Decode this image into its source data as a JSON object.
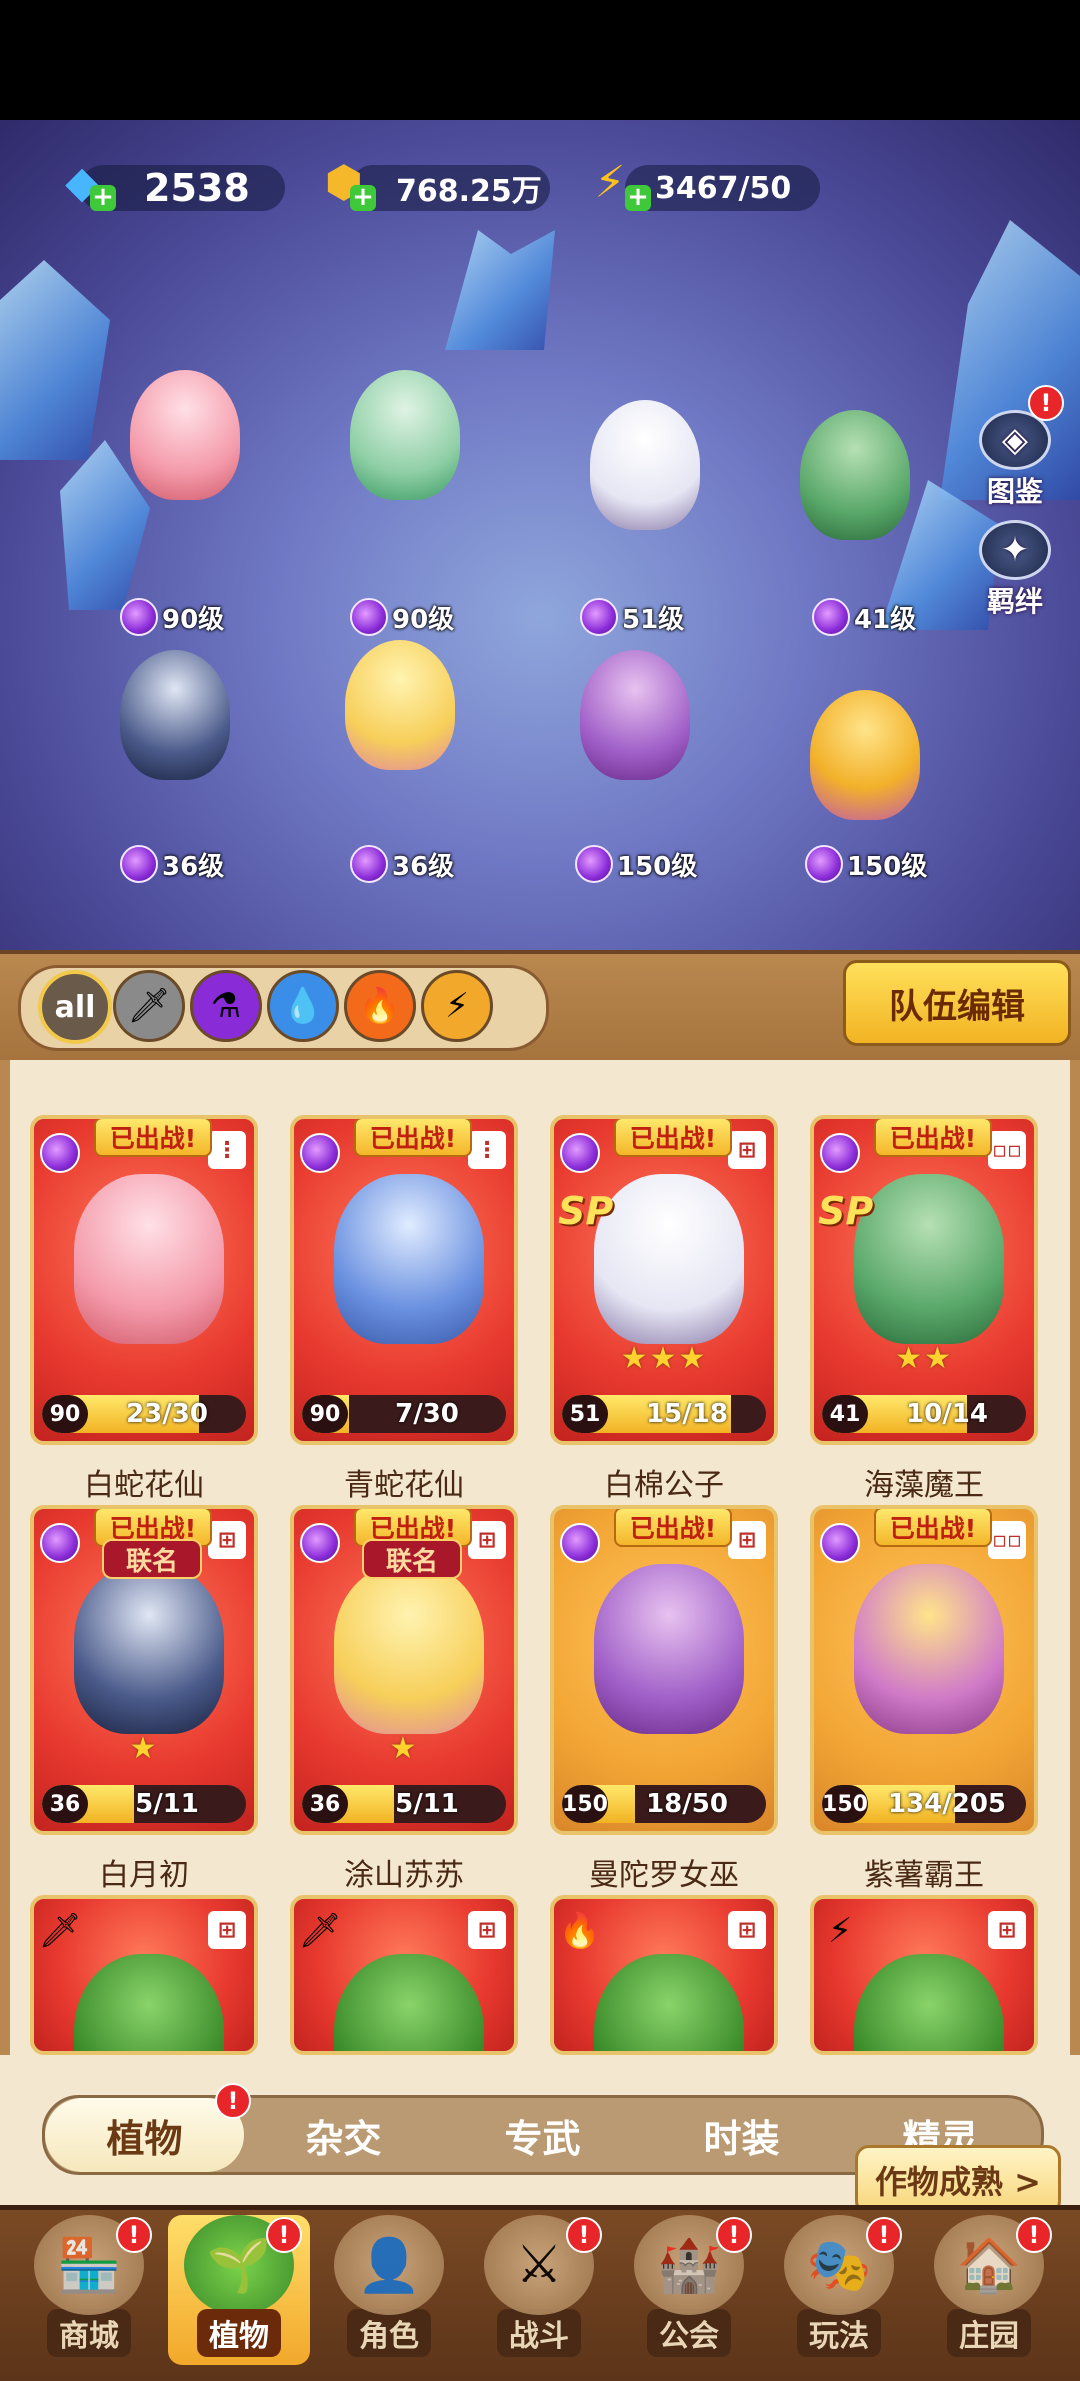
{
  "resources": {
    "gems": "2538",
    "coins": "768.25万",
    "energy": "3467/50"
  },
  "scene": {
    "side_buttons": [
      {
        "label": "图鉴",
        "icon": "codex-icon",
        "badge": "!"
      },
      {
        "label": "羁绊",
        "icon": "bond-icon",
        "badge": ""
      }
    ],
    "heroes": [
      {
        "level": "90级"
      },
      {
        "level": "90级"
      },
      {
        "level": "51级"
      },
      {
        "level": "41级"
      },
      {
        "level": "36级"
      },
      {
        "level": "36级"
      },
      {
        "level": "150级"
      },
      {
        "level": "150级"
      }
    ]
  },
  "filters": {
    "all_label": "all",
    "icons": [
      "sword-icon",
      "potion-icon",
      "water-icon",
      "fire-icon",
      "lightning-icon"
    ]
  },
  "team_edit_label": "队伍编辑",
  "cards": [
    {
      "name": "白蛇花仙",
      "sticker": "已出战!",
      "level": "90",
      "progress": "23/30",
      "fill": 0.77,
      "stars": "",
      "sp": "",
      "lianming": "",
      "theme": "red",
      "dots": "⋮"
    },
    {
      "name": "青蛇花仙",
      "sticker": "已出战!",
      "level": "90",
      "progress": "7/30",
      "fill": 0.23,
      "stars": "",
      "sp": "",
      "lianming": "",
      "theme": "red",
      "dots": "⋮"
    },
    {
      "name": "白棉公子",
      "sticker": "已出战!",
      "level": "51",
      "progress": "15/18",
      "fill": 0.83,
      "stars": "★★★",
      "sp": "SP",
      "lianming": "",
      "theme": "red",
      "dots": "⊞"
    },
    {
      "name": "海藻魔王",
      "sticker": "已出战!",
      "level": "41",
      "progress": "10/14",
      "fill": 0.71,
      "stars": "★★",
      "sp": "SP",
      "lianming": "",
      "theme": "red",
      "dots": "▫▫"
    },
    {
      "name": "白月初",
      "sticker": "已出战!",
      "level": "36",
      "progress": "5/11",
      "fill": 0.45,
      "stars": "★",
      "sp": "",
      "lianming": "联名",
      "theme": "red",
      "dots": "⊞"
    },
    {
      "name": "涂山苏苏",
      "sticker": "已出战!",
      "level": "36",
      "progress": "5/11",
      "fill": 0.45,
      "stars": "★",
      "sp": "",
      "lianming": "联名",
      "theme": "red",
      "dots": "⊞"
    },
    {
      "name": "曼陀罗女巫",
      "sticker": "已出战!",
      "level": "150",
      "progress": "18/50",
      "fill": 0.36,
      "stars": "",
      "sp": "",
      "lianming": "",
      "theme": "gold",
      "dots": "⊞"
    },
    {
      "name": "紫薯霸王",
      "sticker": "已出战!",
      "level": "150",
      "progress": "134/205",
      "fill": 0.65,
      "stars": "",
      "sp": "",
      "lianming": "",
      "theme": "gold",
      "dots": "▫▫"
    }
  ],
  "partial_cards": [
    {
      "icon": "sword-icon",
      "glyph": "🗡",
      "theme": "red"
    },
    {
      "icon": "sword-icon",
      "glyph": "🗡",
      "theme": "red"
    },
    {
      "icon": "fire-icon",
      "glyph": "🔥",
      "theme": "red"
    },
    {
      "icon": "lightning-icon",
      "glyph": "⚡",
      "theme": "red"
    }
  ],
  "subtabs": [
    {
      "label": "植物",
      "active": true,
      "badge": "!"
    },
    {
      "label": "杂交",
      "active": false,
      "badge": ""
    },
    {
      "label": "专武",
      "active": false,
      "badge": ""
    },
    {
      "label": "时装",
      "active": false,
      "badge": ""
    },
    {
      "label": "精灵",
      "active": false,
      "badge": ""
    }
  ],
  "harvest_label": "作物成熟 >",
  "nav": [
    {
      "label": "商城",
      "icon": "shop-icon",
      "active": false,
      "badge": "!"
    },
    {
      "label": "植物",
      "icon": "plant-icon",
      "active": true,
      "badge": "!"
    },
    {
      "label": "角色",
      "icon": "character-icon",
      "active": false,
      "badge": ""
    },
    {
      "label": "战斗",
      "icon": "battle-icon",
      "active": false,
      "badge": "!"
    },
    {
      "label": "公会",
      "icon": "guild-icon",
      "active": false,
      "badge": "!"
    },
    {
      "label": "玩法",
      "icon": "gameplay-icon",
      "active": false,
      "badge": "!"
    },
    {
      "label": "庄园",
      "icon": "manor-icon",
      "active": false,
      "badge": "!"
    }
  ]
}
